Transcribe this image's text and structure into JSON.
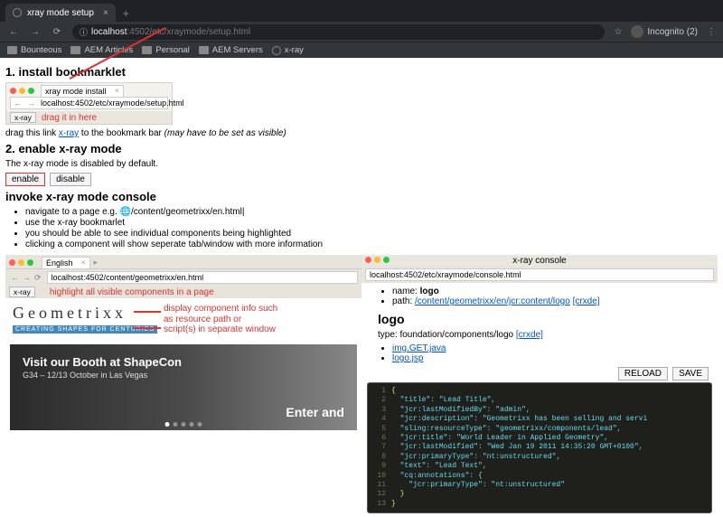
{
  "browser": {
    "tab_title": "xray mode setup",
    "url_host": "localhost",
    "url_port": ":4502",
    "url_path": "/etc/xraymode/setup.html",
    "incognito_label": "Incognito (2)",
    "bookmarks": [
      "Bounteous",
      "AEM Articles",
      "Personal",
      "AEM Servers",
      "x-ray"
    ]
  },
  "page": {
    "h1": "1. install bookmarklet",
    "mini_tab": "xray mode install",
    "mini_url": "localhost:4502/etc/xraymode/setup.html",
    "xray_btn": "x-ray",
    "drag_hint": "drag it in here",
    "drag_line_a": "drag this link ",
    "drag_link": "x-ray",
    "drag_line_b": " to the bookmark bar ",
    "drag_line_c": "(may have to be set as visible)",
    "h2": "2. enable x-ray mode",
    "disabled_line": "The x-ray mode is disabled by default.",
    "btn_enable": "enable",
    "btn_disable": "disable",
    "h3": "invoke x-ray mode console",
    "instr": [
      "navigate to a page e.g. 🌐/content/geometrixx/en.html|",
      "use the x-ray bookmarlet",
      "you should be able to see individual components being highlighted",
      "clicking a component will show seperate tab/window with more information"
    ]
  },
  "left_shot": {
    "tab": "English",
    "url": "localhost:4502/content/geometrixx/en.html",
    "bm_btn": "x-ray",
    "callout1": "highlight all visible components in a page",
    "logo": "Geometrixx",
    "tagline": "CREATING SHAPES FOR CENTURIES",
    "callout2a": "display component info such",
    "callout2b": "as resource path or",
    "callout2c": "script(s) in separate window",
    "hero_title": "Visit our Booth at ShapeCon",
    "hero_sub": "G34 – 12/13 October in Las Vegas",
    "hero_enter": "Enter and"
  },
  "right_shot": {
    "title": "x-ray console",
    "url": "localhost:4502/etc/xraymode/console.html",
    "name_lbl": "name: ",
    "name_val": "logo",
    "path_lbl": "path: ",
    "path_val": "/content/geometrixx/en/jcr:content/logo",
    "crxde": "[crxde]",
    "h_logo": "logo",
    "type_lbl": "type: ",
    "type_val": "foundation/components/logo ",
    "links": [
      "img.GET.java",
      "logo.jsp"
    ],
    "btn_reload": "RELOAD",
    "btn_save": "SAVE"
  },
  "code": {
    "l1": "\"title\": \"Lead Title\",",
    "l2": "\"jcr:lastModifiedBy\": \"admin\",",
    "l3": "\"jcr:description\": \"Geometrixx has been selling and servi",
    "l4": "\"sling:resourceType\": \"geometrixx/components/lead\",",
    "l5": "\"jcr:title\": \"World Leader in Applied Geometry\",",
    "l6": "\"jcr:lastModified\": \"Wed Jan 19 2011 14:35:20 GMT+0100\",",
    "l7": "\"jcr:primaryType\": \"nt:unstructured\",",
    "l8": "\"text\": \"Lead Text\",",
    "l9": "\"cq:annotations\": {",
    "l10": "\"jcr:primaryType\": \"nt:unstructured\""
  }
}
